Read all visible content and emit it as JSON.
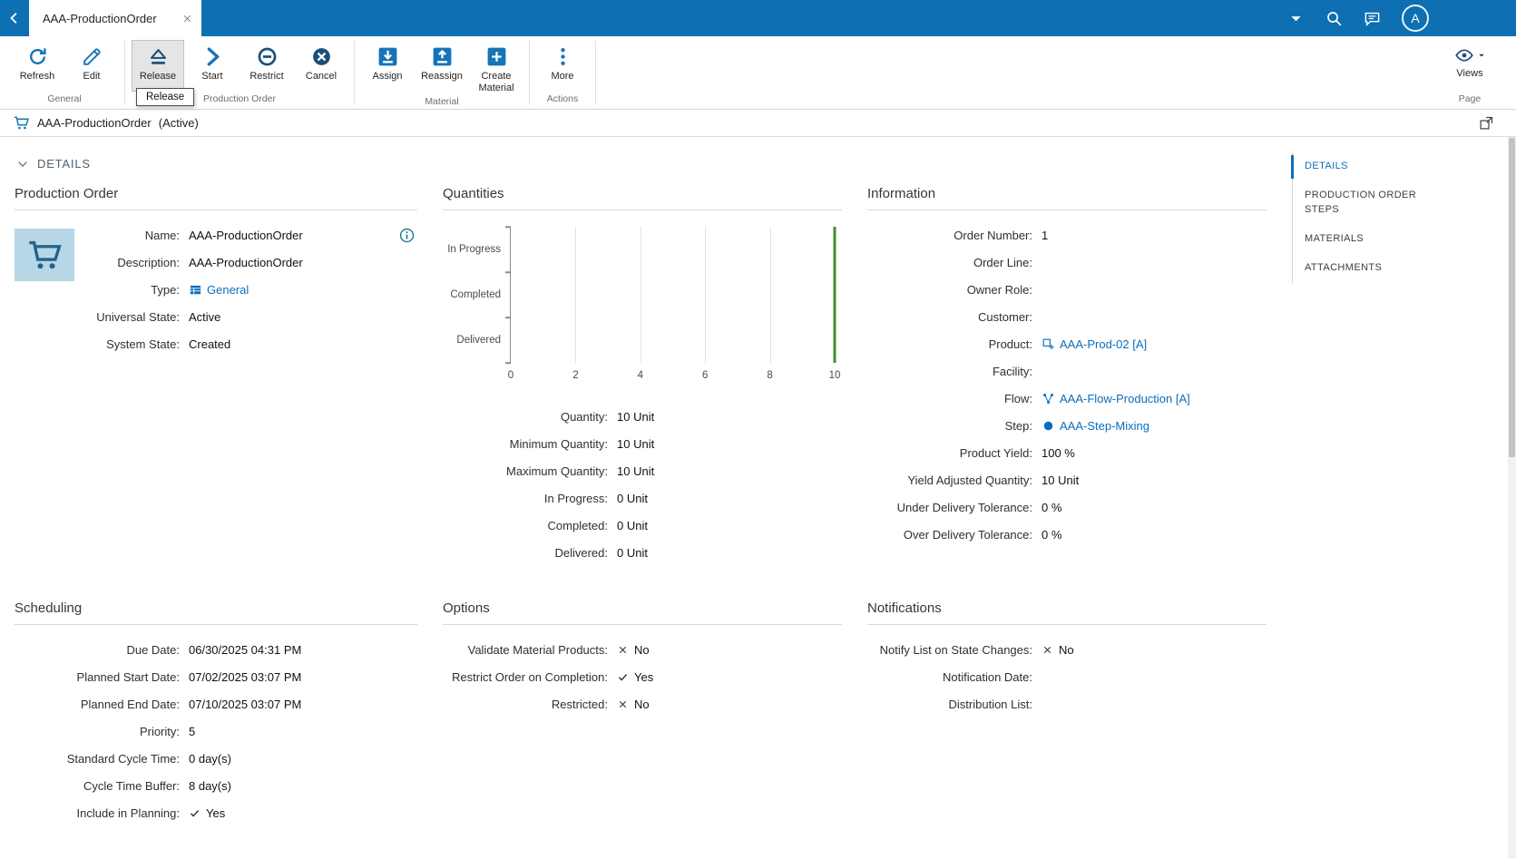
{
  "colors": {
    "topbar": "#0e6fb2",
    "accent": "#1774b8",
    "accent_dark": "#1d4e77",
    "link": "#0a6ebd",
    "target_line_green": "#3f8f29"
  },
  "topbar": {
    "tab_title": "AAA-ProductionOrder",
    "avatar_initial": "A"
  },
  "toolbar": {
    "tooltip": "Release",
    "groups": [
      {
        "label": "General",
        "buttons": [
          {
            "label": "Refresh",
            "icon": "refresh-icon"
          },
          {
            "label": "Edit",
            "icon": "edit-icon"
          }
        ]
      },
      {
        "label": "Production Order",
        "buttons": [
          {
            "label": "Release",
            "icon": "release-icon",
            "dark": true,
            "highlighted": true
          },
          {
            "label": "Start",
            "icon": "start-icon"
          },
          {
            "label": "Restrict",
            "icon": "restrict-icon",
            "dark": true
          },
          {
            "label": "Cancel",
            "icon": "cancel-icon",
            "dark": true
          }
        ]
      },
      {
        "label": "Material",
        "buttons": [
          {
            "label": "Assign",
            "icon": "assign-icon"
          },
          {
            "label": "Reassign",
            "icon": "reassign-icon"
          },
          {
            "label": "Create Material",
            "icon": "create-material-icon"
          }
        ]
      },
      {
        "label": "Actions",
        "buttons": [
          {
            "label": "More",
            "icon": "more-icon"
          }
        ]
      }
    ],
    "page_group": {
      "label": "Page",
      "button_label": "Views"
    }
  },
  "titlebar": {
    "title": "AAA-ProductionOrder",
    "state": "(Active)"
  },
  "details_header": "DETAILS",
  "nav": {
    "items": [
      {
        "label": "DETAILS",
        "active": true
      },
      {
        "label": "PRODUCTION ORDER STEPS"
      },
      {
        "label": "MATERIALS"
      },
      {
        "label": "ATTACHMENTS"
      }
    ]
  },
  "panels": {
    "production_order": {
      "title": "Production Order",
      "fields": [
        {
          "label": "Name:",
          "value": "AAA-ProductionOrder"
        },
        {
          "label": "Description:",
          "value": "AAA-ProductionOrder"
        },
        {
          "label": "Type:",
          "value": "General",
          "kind": "link",
          "icon": "type-icon"
        },
        {
          "label": "Universal State:",
          "value": "Active"
        },
        {
          "label": "System State:",
          "value": "Created"
        }
      ]
    },
    "quantities": {
      "title": "Quantities",
      "fields": [
        {
          "label": "Quantity:",
          "value": "10 Unit"
        },
        {
          "label": "Minimum Quantity:",
          "value": "10 Unit"
        },
        {
          "label": "Maximum Quantity:",
          "value": "10 Unit"
        },
        {
          "label": "In Progress:",
          "value": "0 Unit"
        },
        {
          "label": "Completed:",
          "value": "0 Unit"
        },
        {
          "label": "Delivered:",
          "value": "0 Unit"
        }
      ]
    },
    "information": {
      "title": "Information",
      "fields": [
        {
          "label": "Order Number:",
          "value": "1"
        },
        {
          "label": "Order Line:",
          "value": ""
        },
        {
          "label": "Owner Role:",
          "value": ""
        },
        {
          "label": "Customer:",
          "value": ""
        },
        {
          "label": "Product:",
          "value": "AAA-Prod-02 [A]",
          "kind": "link",
          "icon": "product-icon"
        },
        {
          "label": "Facility:",
          "value": ""
        },
        {
          "label": "Flow:",
          "value": "AAA-Flow-Production [A]",
          "kind": "link",
          "icon": "flow-icon"
        },
        {
          "label": "Step:",
          "value": "AAA-Step-Mixing",
          "kind": "link",
          "icon": "step-icon"
        },
        {
          "label": "Product Yield:",
          "value": "100 %"
        },
        {
          "label": "Yield Adjusted Quantity:",
          "value": "10 Unit"
        },
        {
          "label": "Under Delivery Tolerance:",
          "value": "0 %"
        },
        {
          "label": "Over Delivery Tolerance:",
          "value": "0 %"
        }
      ]
    },
    "scheduling": {
      "title": "Scheduling",
      "fields": [
        {
          "label": "Due Date:",
          "value": "06/30/2025 04:31 PM"
        },
        {
          "label": "Planned Start Date:",
          "value": "07/02/2025 03:07 PM"
        },
        {
          "label": "Planned End Date:",
          "value": "07/10/2025 03:07 PM"
        },
        {
          "label": "Priority:",
          "value": "5"
        },
        {
          "label": "Standard Cycle Time:",
          "value": "0 day(s)"
        },
        {
          "label": "Cycle Time Buffer:",
          "value": "8 day(s)"
        },
        {
          "label": "Include in Planning:",
          "value": "Yes",
          "kind": "yes"
        }
      ]
    },
    "options": {
      "title": "Options",
      "fields": [
        {
          "label": "Validate Material Products:",
          "value": "No",
          "kind": "no"
        },
        {
          "label": "Restrict Order on Completion:",
          "value": "Yes",
          "kind": "yes"
        },
        {
          "label": "Restricted:",
          "value": "No",
          "kind": "no"
        }
      ]
    },
    "notifications": {
      "title": "Notifications",
      "fields": [
        {
          "label": "Notify List on State Changes:",
          "value": "No",
          "kind": "no"
        },
        {
          "label": "Notification Date:",
          "value": ""
        },
        {
          "label": "Distribution List:",
          "value": ""
        }
      ]
    }
  },
  "chart_data": {
    "type": "bar",
    "orientation": "horizontal",
    "title": "Quantities",
    "categories": [
      "In Progress",
      "Completed",
      "Delivered"
    ],
    "values": [
      0,
      0,
      0
    ],
    "xlim": [
      0,
      10
    ],
    "xticks": [
      0,
      2,
      4,
      6,
      8,
      10
    ],
    "target_line": {
      "value": 10,
      "color": "#3f8f29"
    },
    "grid": true,
    "legend": false
  }
}
